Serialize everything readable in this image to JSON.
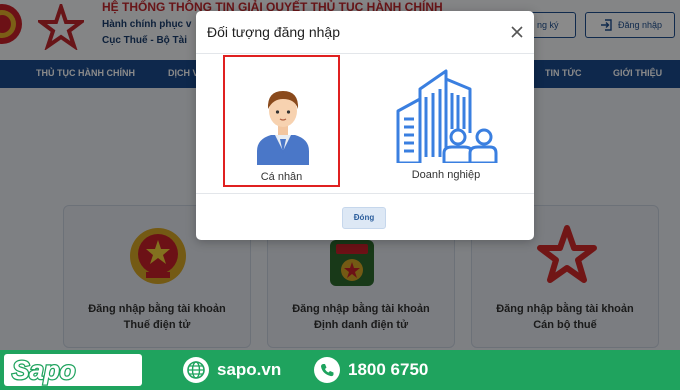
{
  "header": {
    "title": "HỆ THỐNG THÔNG TIN GIẢI QUYẾT THỦ TỤC HÀNH CHÍNH",
    "subtitle1": "Hành chính phục v",
    "subtitle2": "Cục Thuế - Bộ Tài",
    "register_label": "ng ký",
    "login_label": "Đăng nhập"
  },
  "nav": {
    "items": [
      "THỦ TỤC HÀNH CHÍNH",
      "DỊCH V",
      "TIN TỨC",
      "GIỚI THIỆU"
    ]
  },
  "cards": [
    {
      "line1": "Đăng nhập bằng tài khoản",
      "line2": "Thuế điện tử"
    },
    {
      "line1": "Đăng nhập bằng tài khoản",
      "line2": "Định danh điện tử"
    },
    {
      "line1": "Đăng nhập bằng tài khoản",
      "line2": "Cán bộ thuế"
    }
  ],
  "modal": {
    "title": "Đối tượng đăng nhập",
    "options": [
      {
        "label": "Cá nhân",
        "selected": true,
        "icon": "person-icon"
      },
      {
        "label": "Doanh nghiệp",
        "selected": false,
        "icon": "buildings-icon"
      }
    ],
    "close_label": "Đóng"
  },
  "footer": {
    "brand": "Sapo",
    "website": "sapo.vn",
    "phone": "1800 6750"
  },
  "colors": {
    "nav": "#1b4a8c",
    "header_title": "#c0272d",
    "selected_border": "#e02020",
    "footer": "#1fa35e"
  }
}
